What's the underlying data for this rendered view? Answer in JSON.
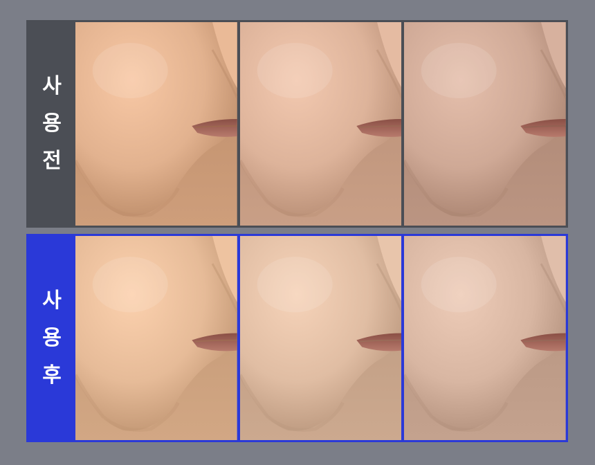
{
  "before": {
    "label_chars": [
      "사",
      "용",
      "전"
    ],
    "frame_color": "#4b4e55",
    "skin_tones": [
      "#e2b28f",
      "#ddb39a",
      "#cfa996"
    ]
  },
  "after": {
    "label_chars": [
      "사",
      "용",
      "후"
    ],
    "frame_color": "#2a39d8",
    "skin_tones": [
      "#e6bb98",
      "#e0bda3",
      "#d8b6a2"
    ]
  },
  "background_color": "#7b7e88"
}
